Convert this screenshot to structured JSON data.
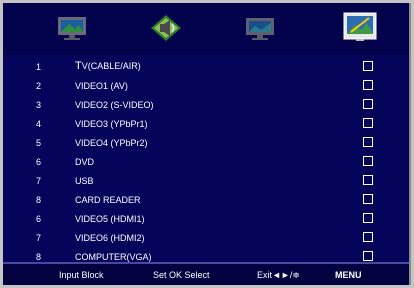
{
  "colors": {
    "panel": "#04045a",
    "frame": "#c4c4c4",
    "text": "#ffffff",
    "footer": "#020240"
  },
  "tabs": [
    {
      "icon": "tv-picture-icon",
      "selected": false
    },
    {
      "icon": "sound-icon",
      "selected": false
    },
    {
      "icon": "monitor-setup-icon",
      "selected": false
    },
    {
      "icon": "input-block-icon",
      "selected": true
    }
  ],
  "items": [
    {
      "num": "1",
      "prefix": "T",
      "label": "V(CABLE/AIR)"
    },
    {
      "num": "2",
      "label": "VIDEO1 (AV)"
    },
    {
      "num": "3",
      "label": "VIDEO2 (S-VIDEO)"
    },
    {
      "num": "4",
      "label": "VIDEO3 (YPbPr1)"
    },
    {
      "num": "5",
      "label": "VIDEO4 (YPbPr2)"
    },
    {
      "num": "6",
      "label": "DVD"
    },
    {
      "num": "7",
      "label": "USB"
    },
    {
      "num": "8",
      "label": "CARD READER"
    },
    {
      "num": "6",
      "label": "VIDEO5 (HDMI1)"
    },
    {
      "num": "7",
      "label": "VIDEO6 (HDMI2)"
    },
    {
      "num": "8",
      "label": "COMPUTER(VGA)"
    }
  ],
  "footer": {
    "title": "Input Block",
    "set_hint": "Set OK Select",
    "exit_hint": "Exit◄►/≑",
    "menu": "MENU"
  }
}
